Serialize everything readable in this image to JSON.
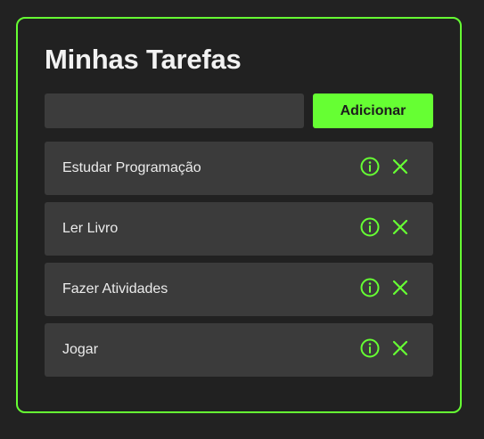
{
  "app": {
    "title": "Minhas Tarefas"
  },
  "form": {
    "input_value": "",
    "input_placeholder": "",
    "add_label": "Adicionar"
  },
  "tasks": [
    {
      "label": "Estudar Programação"
    },
    {
      "label": "Ler Livro"
    },
    {
      "label": "Fazer Atividades"
    },
    {
      "label": "Jogar"
    }
  ],
  "icons": {
    "details": "info-circle-icon",
    "delete": "close-x-icon"
  },
  "colors": {
    "accent": "#66ff33",
    "background": "#222222",
    "card": "#3b3b3b",
    "text": "#f2f2f2"
  }
}
